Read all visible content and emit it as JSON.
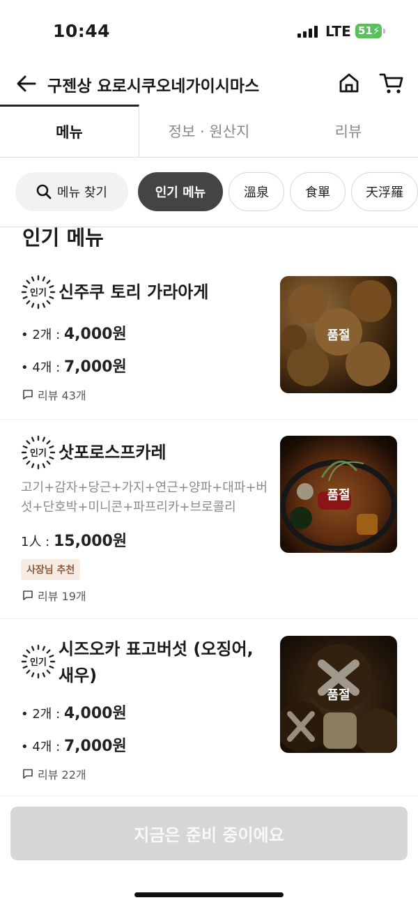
{
  "status_bar": {
    "time": "10:44",
    "network": "LTE",
    "battery": "51"
  },
  "header": {
    "title": "구젠상 요로시쿠오네가이시마스",
    "back_icon": "arrow-left-icon",
    "home_icon": "home-icon",
    "cart_icon": "cart-icon"
  },
  "tabs": [
    {
      "label": "메뉴",
      "active": true
    },
    {
      "label": "정보 · 원산지",
      "active": false
    },
    {
      "label": "리뷰",
      "active": false
    }
  ],
  "chips": {
    "search_label": "메뉴 찾기",
    "items": [
      {
        "label": "인기 메뉴",
        "active": true
      },
      {
        "label": "溫泉"
      },
      {
        "label": "食單"
      },
      {
        "label": "天浮羅"
      }
    ]
  },
  "section_title": "인기 메뉴",
  "badge_label": "인기",
  "sold_out_label": "품절",
  "items": [
    {
      "name": "신주쿠 토리 가라아게",
      "prices": [
        {
          "label": "• 2개 : ",
          "value": "4,000원"
        },
        {
          "label": "• 4개 : ",
          "value": "7,000원"
        }
      ],
      "review": "리뷰 43개"
    },
    {
      "name": "삿포로스프카레",
      "description": "고기+감자+당근+가지+연근+양파+대파+버섯+단호박+미니콘+파프리카+브로콜리",
      "prices": [
        {
          "label": "1人 : ",
          "value": "15,000원"
        }
      ],
      "recommend": "사장님 추천",
      "review": "리뷰 19개"
    },
    {
      "name": "시즈오카 표고버섯 (오징어, 새우)",
      "prices": [
        {
          "label": "• 2개 : ",
          "value": "4,000원"
        },
        {
          "label": "• 4개 : ",
          "value": "7,000원"
        }
      ],
      "review": "리뷰 22개"
    }
  ],
  "bottom_button": "지금은 준비 중이에요",
  "colors": {
    "active_chip": "#444444",
    "disabled_button": "#d5d6d8",
    "recommend_bg": "#f6ece4",
    "recommend_text": "#8a5a3c"
  }
}
